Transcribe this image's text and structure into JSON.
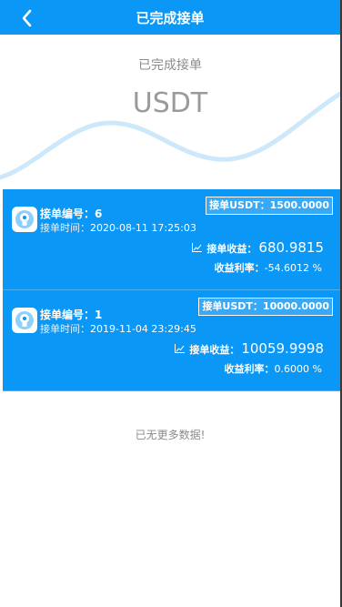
{
  "header": {
    "title": "已完成接单"
  },
  "hero": {
    "subtitle": "已完成接单",
    "currency": "USDT"
  },
  "orders": [
    {
      "no_label": "接单编号：",
      "no_value": "6",
      "time_label": "接单时间：",
      "time_value": "2020-08-11 17:25:03",
      "amount_text": "接单USDT：1500.0000",
      "income_label": "接单收益：",
      "income_value": "680.9815",
      "rate_label": "收益利率：",
      "rate_value": "-54.6012 %"
    },
    {
      "no_label": "接单编号：",
      "no_value": "1",
      "time_label": "接单时间：",
      "time_value": "2019-11-04 23:29:45",
      "amount_text": "接单USDT：10000.0000",
      "income_label": "接单收益：",
      "income_value": "10059.9998",
      "rate_label": "收益利率：",
      "rate_value": "0.6000 %"
    }
  ],
  "footer": {
    "no_more": "已无更多数据!"
  },
  "colors": {
    "primary": "#0b97f5",
    "text_gray": "#8c8c8c",
    "wave": "#cde8fb"
  },
  "icons": {
    "back": "chevron-left-icon",
    "card": "lightbulb-icon",
    "income": "line-chart-icon"
  }
}
